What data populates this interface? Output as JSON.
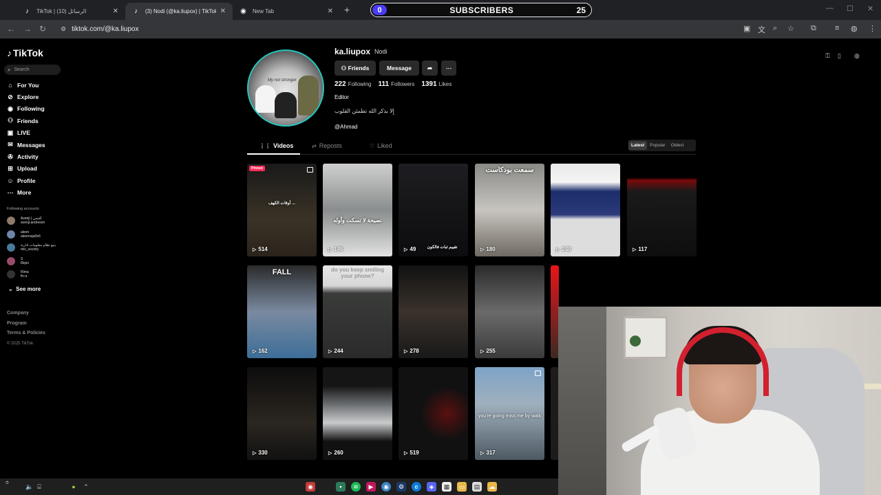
{
  "browser": {
    "tabs": [
      {
        "title": "TikTok | الرسائل (10)",
        "active": false
      },
      {
        "title": "(3) Nodi (@ka.liupox) | TikTok",
        "active": true
      },
      {
        "title": "New Tab",
        "active": false
      }
    ],
    "url": "tiktok.com/@ka.liupox"
  },
  "overlay": {
    "subscribers_label": "SUBSCRIBERS",
    "current": "0",
    "goal": "25"
  },
  "sidebar": {
    "logo": "TikTok",
    "search_placeholder": "Search",
    "menu": [
      {
        "label": "For You",
        "icon": "home-icon"
      },
      {
        "label": "Explore",
        "icon": "compass-icon"
      },
      {
        "label": "Following",
        "icon": "following-icon"
      },
      {
        "label": "Friends",
        "icon": "friends-icon"
      },
      {
        "label": "LIVE",
        "icon": "live-icon"
      },
      {
        "label": "Messages",
        "icon": "messages-icon"
      },
      {
        "label": "Activity",
        "icon": "activity-icon"
      },
      {
        "label": "Upload",
        "icon": "upload-icon"
      },
      {
        "label": "Profile",
        "icon": "profile-icon"
      },
      {
        "label": "More",
        "icon": "more-icon"
      }
    ],
    "following_header": "Following accounts",
    "following_accounts": [
      {
        "name": "Avenji | أفنجي",
        "handle": "avenji.andresen"
      },
      {
        "name": "aleen",
        "handle": "aleensquillv6"
      },
      {
        "name": "يتبع نظام معلومات ادارية",
        "handle": "mis_society"
      },
      {
        "name": "S",
        "handle": "8lqioi"
      },
      {
        "name": "Rima",
        "handle": "fic:a"
      }
    ],
    "see_more": "See more",
    "footer": [
      "Company",
      "Program",
      "Terms & Policies"
    ],
    "copyright": "© 2025 TikTok"
  },
  "profile": {
    "username": "ka.liupox",
    "nickname": "Nodi",
    "buttons": {
      "friends": "Friends",
      "message": "Message"
    },
    "stats": [
      {
        "value": "222",
        "label": "Following"
      },
      {
        "value": "111",
        "label": "Followers"
      },
      {
        "value": "1391",
        "label": "Likes"
      }
    ],
    "role": "Editor",
    "bio": "إِلا بذكر الله تطمئن القلوب",
    "link": "@Ahmad",
    "avatar_text": "My not stronger"
  },
  "tabs": {
    "videos": "Videos",
    "reposts": "Reposts",
    "liked": "Liked",
    "sort": [
      "Latest",
      "Popular",
      "Oldest"
    ]
  },
  "videos": [
    {
      "views": "514",
      "caption": "أوقات الكهف ...",
      "pinned": "Pinned"
    },
    {
      "views": "146",
      "caption": "نصيحة لا تسكت وأوله"
    },
    {
      "views": "49",
      "caption": "تقييم ثبات فالكون"
    },
    {
      "views": "180",
      "caption": "سمعت بودكاست"
    },
    {
      "views": "248",
      "caption": ""
    },
    {
      "views": "117",
      "caption": ""
    },
    {
      "views": "162",
      "caption": "FALL"
    },
    {
      "views": "244",
      "caption": "do you keep smiling your phone?"
    },
    {
      "views": "278",
      "caption": ""
    },
    {
      "views": "255",
      "caption": ""
    },
    {
      "views": "330",
      "caption": ""
    },
    {
      "views": "260",
      "caption": ""
    },
    {
      "views": "519",
      "caption": ""
    },
    {
      "views": "317",
      "caption": "you're going miss me by walk"
    }
  ],
  "colors": {
    "accent": "#fe2c55",
    "avatar_ring": "#25c6bd",
    "sub_bar": "#4b3cf5"
  }
}
